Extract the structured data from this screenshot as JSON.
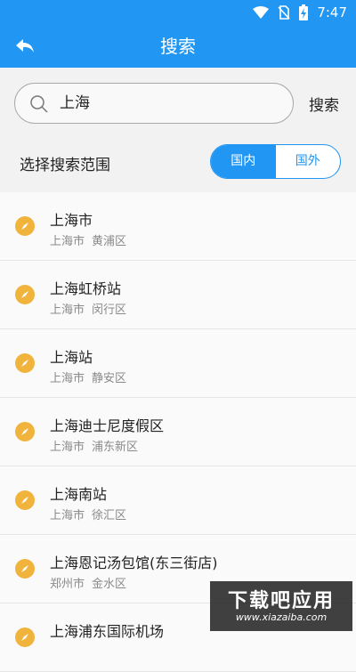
{
  "status": {
    "time": "7:47"
  },
  "toolbar": {
    "title": "搜索"
  },
  "search": {
    "value": "上海",
    "button_label": "搜索"
  },
  "scope": {
    "label": "选择搜索范围",
    "domestic": "国内",
    "international": "国外",
    "selected": "国内"
  },
  "results": [
    {
      "name": "上海市",
      "city": "上海市",
      "district": "黄浦区"
    },
    {
      "name": "上海虹桥站",
      "city": "上海市",
      "district": "闵行区"
    },
    {
      "name": "上海站",
      "city": "上海市",
      "district": "静安区"
    },
    {
      "name": "上海迪士尼度假区",
      "city": "上海市",
      "district": "浦东新区"
    },
    {
      "name": "上海南站",
      "city": "上海市",
      "district": "徐汇区"
    },
    {
      "name": "上海恩记汤包馆(东三街店)",
      "city": "郑州市",
      "district": "金水区"
    },
    {
      "name": "上海浦东国际机场",
      "city": "",
      "district": ""
    }
  ],
  "watermark": {
    "title": "下载吧应用",
    "url": "www.xiazaiba.com"
  },
  "colors": {
    "primary": "#2196f3",
    "pin": "#f0b33c"
  },
  "icons": [
    "wifi-icon",
    "no-sim-icon",
    "battery-charging-icon",
    "back-arrow-icon",
    "search-icon",
    "compass-icon"
  ]
}
